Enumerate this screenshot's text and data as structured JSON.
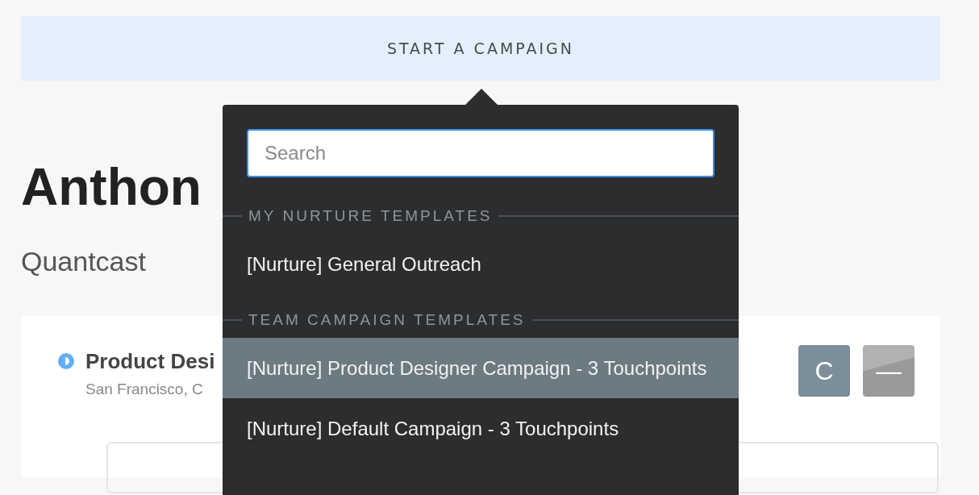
{
  "banner": {
    "label": "START A CAMPAIGN"
  },
  "contact": {
    "name": "Anthon",
    "company": "Quantcast"
  },
  "position": {
    "title": "Product Desi",
    "location": "San Francisco, C",
    "status_icon": true
  },
  "actions": [
    {
      "label": "C",
      "kind": "initial"
    },
    {
      "label": "—",
      "kind": "minus"
    }
  ],
  "dropdown": {
    "search": {
      "placeholder": "Search"
    },
    "sections": [
      {
        "title": "MY NURTURE TEMPLATES",
        "items": [
          {
            "label": "[Nurture] General Outreach",
            "selected": false
          }
        ]
      },
      {
        "title": "TEAM CAMPAIGN TEMPLATES",
        "items": [
          {
            "label": "[Nurture] Product Designer Campaign - 3 Touchpoints",
            "selected": true
          },
          {
            "label": "[Nurture] Default Campaign - 3 Touchpoints",
            "selected": false
          }
        ]
      }
    ]
  }
}
